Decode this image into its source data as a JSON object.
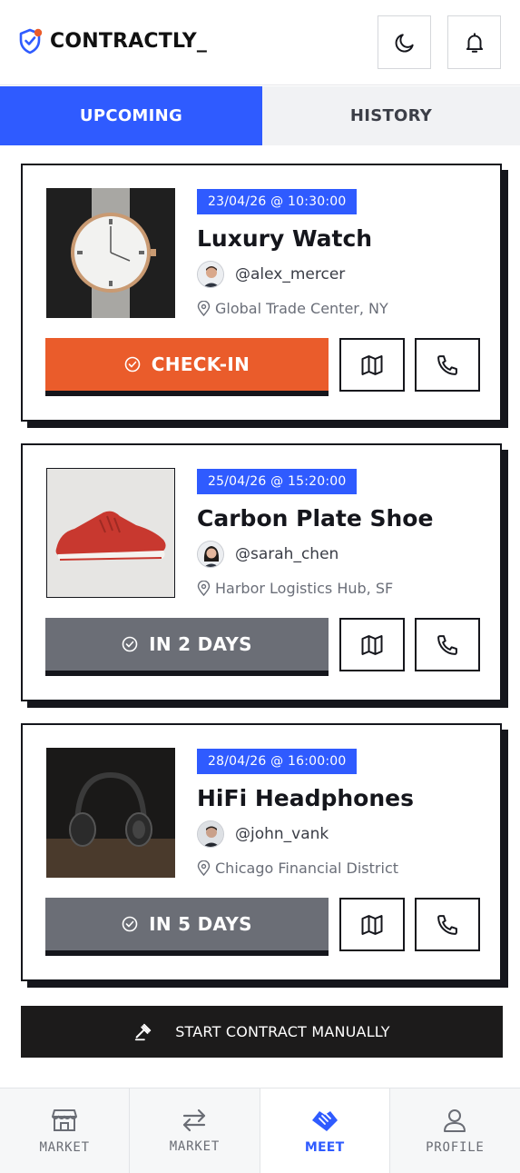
{
  "app": {
    "name": "CONTRACTLY_"
  },
  "colors": {
    "accent": "#2f5bff",
    "checkin": "#ea5c2b",
    "pending": "#6b6e76",
    "ink": "#15161c"
  },
  "tabs": [
    {
      "label": "UPCOMING",
      "active": true
    },
    {
      "label": "HISTORY",
      "active": false
    }
  ],
  "meetings": [
    {
      "date": "23/04/26 @ 10:30:00",
      "title": "Luxury Watch",
      "user": "@alex_mercer",
      "location": "Global Trade Center, NY",
      "action": "CHECK-IN",
      "image_icon": "watch-photo"
    },
    {
      "date": "25/04/26 @ 15:20:00",
      "title": "Carbon Plate Shoe",
      "user": "@sarah_chen",
      "location": "Harbor Logistics Hub, SF",
      "action": "IN 2 DAYS",
      "image_icon": "shoe-photo"
    },
    {
      "date": "28/04/26 @ 16:00:00",
      "title": "HiFi Headphones",
      "user": "@john_vank",
      "location": "Chicago Financial District",
      "action": "IN 5 DAYS",
      "image_icon": "headphones-photo"
    }
  ],
  "start_contract": {
    "label": "START CONTRACT MANUALLY"
  },
  "bottom_nav": [
    {
      "label": "MARKET",
      "icon": "store-icon",
      "active": false
    },
    {
      "label": "MARKET",
      "icon": "swap-arrows-icon",
      "active": false
    },
    {
      "label": "MEET",
      "icon": "handshake-icon",
      "active": true
    },
    {
      "label": "PROFILE",
      "icon": "user-icon",
      "active": false
    }
  ]
}
